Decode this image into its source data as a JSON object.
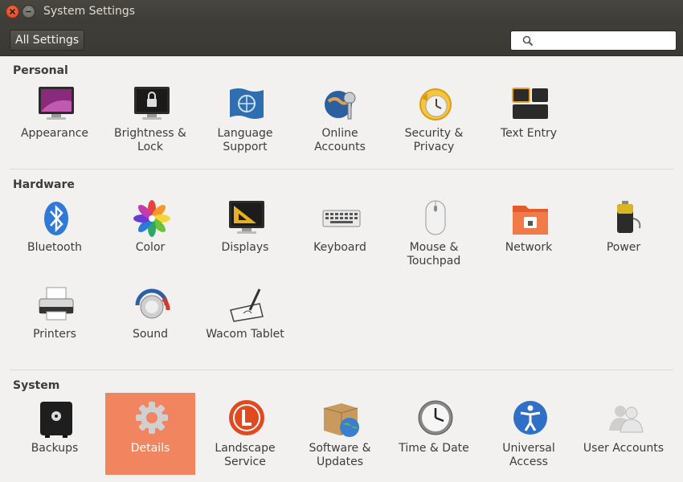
{
  "window": {
    "title": "System Settings"
  },
  "toolbar": {
    "all_settings_label": "All Settings",
    "search_placeholder": "",
    "search_value": ""
  },
  "sections": {
    "personal": {
      "title": "Personal",
      "items": [
        {
          "label": "Appearance",
          "icon": "appearance-icon"
        },
        {
          "label": "Brightness &\nLock",
          "icon": "brightness-lock-icon"
        },
        {
          "label": "Language\nSupport",
          "icon": "language-icon"
        },
        {
          "label": "Online\nAccounts",
          "icon": "online-accounts-icon"
        },
        {
          "label": "Security &\nPrivacy",
          "icon": "security-privacy-icon"
        },
        {
          "label": "Text Entry",
          "icon": "text-entry-icon"
        }
      ]
    },
    "hardware": {
      "title": "Hardware",
      "items": [
        {
          "label": "Bluetooth",
          "icon": "bluetooth-icon"
        },
        {
          "label": "Color",
          "icon": "color-icon"
        },
        {
          "label": "Displays",
          "icon": "displays-icon"
        },
        {
          "label": "Keyboard",
          "icon": "keyboard-icon"
        },
        {
          "label": "Mouse &\nTouchpad",
          "icon": "mouse-icon"
        },
        {
          "label": "Network",
          "icon": "network-icon"
        },
        {
          "label": "Power",
          "icon": "power-icon"
        },
        {
          "label": "Printers",
          "icon": "printer-icon"
        },
        {
          "label": "Sound",
          "icon": "sound-icon"
        },
        {
          "label": "Wacom Tablet",
          "icon": "wacom-tablet-icon"
        }
      ]
    },
    "system": {
      "title": "System",
      "items": [
        {
          "label": "Backups",
          "icon": "backups-icon"
        },
        {
          "label": "Details",
          "icon": "details-gear-icon",
          "selected": true
        },
        {
          "label": "Landscape\nService",
          "icon": "landscape-icon"
        },
        {
          "label": "Software &\nUpdates",
          "icon": "software-updates-icon"
        },
        {
          "label": "Time & Date",
          "icon": "clock-icon"
        },
        {
          "label": "Universal\nAccess",
          "icon": "universal-access-icon"
        },
        {
          "label": "User Accounts",
          "icon": "user-accounts-icon"
        }
      ]
    }
  },
  "colors": {
    "selected_bg": "#f08560",
    "titlebar": "#3c3b37",
    "window_bg": "#f2f1f0"
  }
}
